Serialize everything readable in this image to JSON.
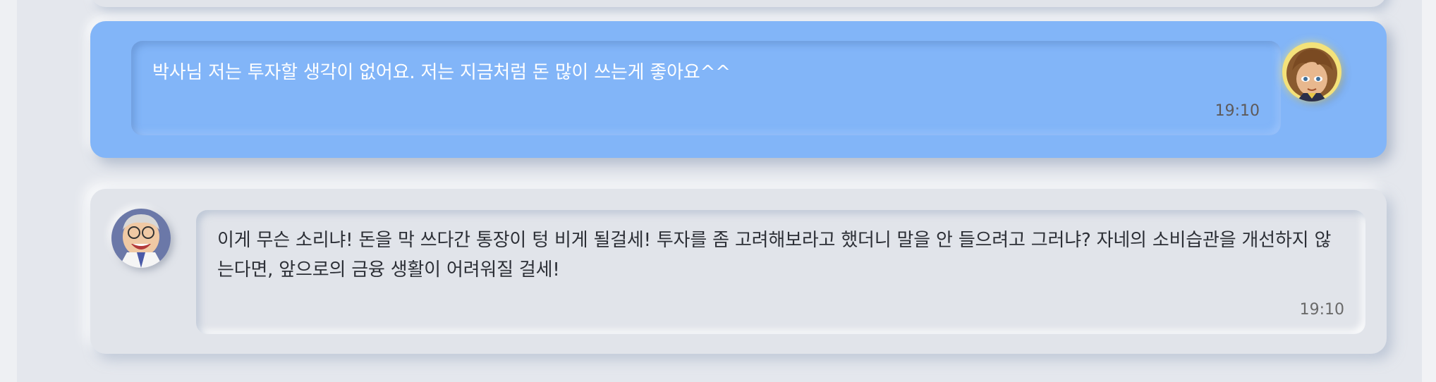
{
  "messages": [
    {
      "sender": "user",
      "text": "박사님 저는 투자할 생각이 없어요. 저는 지금처럼 돈 많이 쓰는게 좋아요^^",
      "time": "19:10",
      "avatar_icon": "user-avatar-icon"
    },
    {
      "sender": "assistant",
      "text": "이게 무슨 소리냐! 돈을 막 쓰다간 통장이 텅 비게 될걸세! 투자를 좀 고려해보라고 했더니 말을 안 들으려고 그러냐? 자네의 소비습관을 개선하지 않는다면, 앞으로의 금융 생활이 어려워질 걸세!",
      "time": "19:10",
      "avatar_icon": "professor-avatar-icon"
    }
  ],
  "colors": {
    "user_bubble": "#82b5f8",
    "assistant_bubble": "#e1e4ea",
    "background": "#e4e7ed"
  }
}
